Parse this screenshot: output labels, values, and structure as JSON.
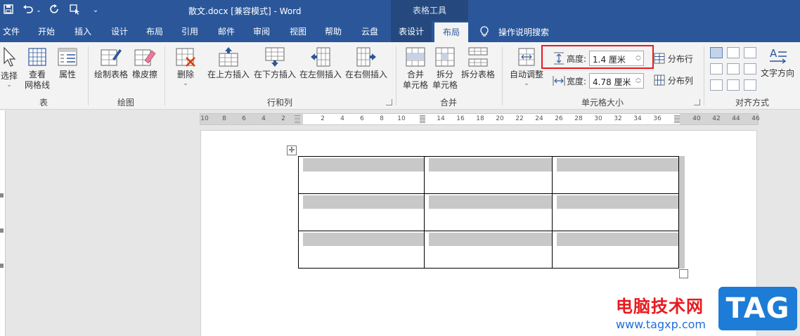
{
  "app": {
    "document_title": "散文.docx [兼容模式] - Word",
    "context_group_label": "表格工具"
  },
  "tabs": {
    "file": "文件",
    "home": "开始",
    "insert": "插入",
    "design": "设计",
    "layout": "布局",
    "references": "引用",
    "mailings": "邮件",
    "review": "审阅",
    "view": "视图",
    "help": "帮助",
    "cloud": "云盘",
    "table_design": "表设计",
    "table_layout": "布局",
    "tell_me": "操作说明搜索"
  },
  "ribbon": {
    "table_group": {
      "label": "表",
      "select": "选择",
      "view_gridlines_1": "查看",
      "view_gridlines_2": "网格线",
      "properties": "属性"
    },
    "draw_group": {
      "label": "绘图",
      "draw_table": "绘制表格",
      "eraser": "橡皮擦"
    },
    "rows_cols_group": {
      "label": "行和列",
      "delete": "删除",
      "insert_above": "在上方插入",
      "insert_below": "在下方插入",
      "insert_left": "在左侧插入",
      "insert_right": "在右侧插入"
    },
    "merge_group": {
      "label": "合并",
      "merge_cells_1": "合并",
      "merge_cells_2": "单元格",
      "split_cells_1": "拆分",
      "split_cells_2": "单元格",
      "split_table": "拆分表格"
    },
    "cell_size_group": {
      "label": "单元格大小",
      "autofit": "自动调整",
      "height_label": "高度:",
      "height_value": "1.4 厘米",
      "width_label": "宽度:",
      "width_value": "4.78 厘米",
      "distribute_rows": "分布行",
      "distribute_cols": "分布列"
    },
    "alignment_group": {
      "label": "对齐方式",
      "text_direction": "文字方向"
    }
  },
  "ruler": {
    "left_numbers": [
      "10",
      "8",
      "6",
      "4",
      "2"
    ],
    "right_numbers": [
      "2",
      "4",
      "6",
      "8",
      "10",
      "14",
      "16",
      "18",
      "20",
      "22",
      "24",
      "26",
      "28",
      "30",
      "32",
      "34",
      "36",
      "40",
      "42",
      "44",
      "46"
    ]
  },
  "table": {
    "rows": 3,
    "cols": 3
  },
  "watermark": {
    "site_name": "电脑技术网",
    "url": "www.tagxp.com",
    "logo_text": "TAG"
  },
  "colors": {
    "word_blue": "#2b579a",
    "highlight_red": "#e8191e"
  }
}
